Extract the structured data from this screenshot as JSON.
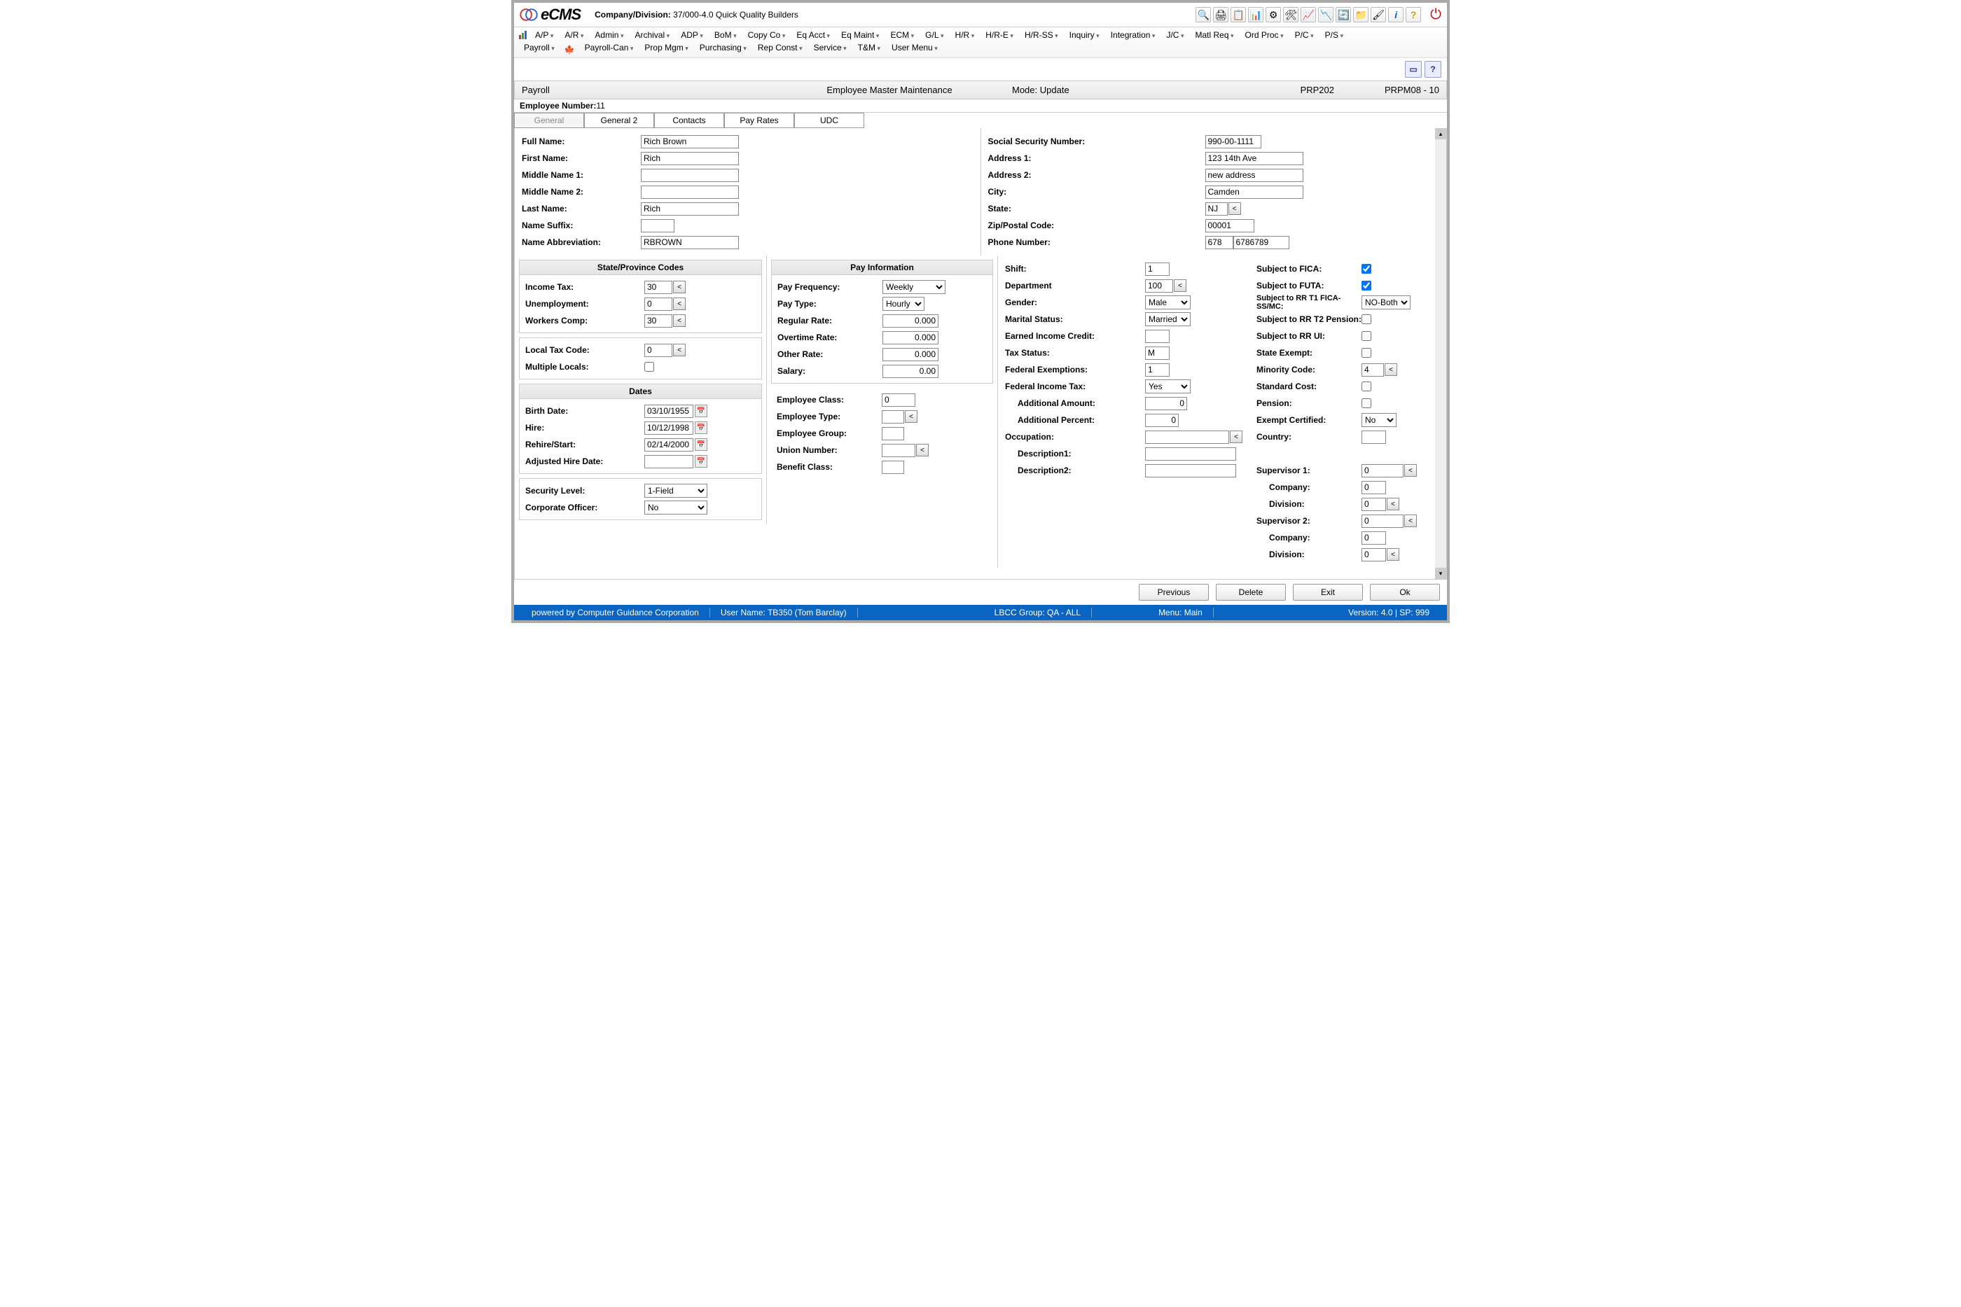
{
  "header": {
    "app_name": "eCMS",
    "company_division_label": "Company/Division:",
    "company_division_value": "37/000-4.0 Quick Quality Builders"
  },
  "toolbar_icons": [
    "🔍",
    "🖨",
    "📋",
    "📊",
    "⚙",
    "🛠",
    "📈",
    "📉",
    "🔄",
    "📁",
    "🖌",
    "ℹ",
    "?"
  ],
  "menu_row1": [
    "A/P",
    "A/R",
    "Admin",
    "Archival",
    "ADP",
    "BoM",
    "Copy Co",
    "Eq Acct",
    "Eq Maint",
    "ECM",
    "G/L",
    "H/R",
    "H/R-E",
    "H/R-SS",
    "Inquiry",
    "Integration",
    "J/C",
    "Matl Req",
    "Ord Proc",
    "P/C",
    "P/S"
  ],
  "menu_row2": [
    "Payroll",
    "Payroll-Can",
    "Prop Mgm",
    "Purchasing",
    "Rep Const",
    "Service",
    "T&M",
    "User Menu"
  ],
  "title": {
    "module": "Payroll",
    "screen": "Employee Master Maintenance",
    "mode_label": "Mode:",
    "mode_value": "Update",
    "code1": "PRP202",
    "code2": "PRPM08 - 10"
  },
  "emp": {
    "label": "Employee Number:",
    "value": "11"
  },
  "tabs": [
    "General",
    "General 2",
    "Contacts",
    "Pay Rates",
    "UDC"
  ],
  "personal": {
    "full_name_l": "Full Name:",
    "full_name": "Rich Brown",
    "first_name_l": "First Name:",
    "first_name": "Rich",
    "mid1_l": "Middle Name 1:",
    "mid1": "",
    "mid2_l": "Middle Name 2:",
    "mid2": "",
    "last_l": "Last Name:",
    "last": "Rich",
    "suffix_l": "Name Suffix:",
    "suffix": "",
    "abbr_l": "Name Abbreviation:",
    "abbr": "RBROWN",
    "ssn_l": "Social Security Number:",
    "ssn": "990-00-1111",
    "addr1_l": "Address 1:",
    "addr1": "123 14th Ave",
    "addr2_l": "Address 2:",
    "addr2": "new address",
    "city_l": "City:",
    "city": "Camden",
    "state_l": "State:",
    "state": "NJ",
    "zip_l": "Zip/Postal Code:",
    "zip": "00001",
    "phone_l": "Phone Number:",
    "phone_area": "678",
    "phone_num": "6786789"
  },
  "state_codes": {
    "head": "State/Province Codes",
    "income_l": "Income Tax:",
    "income": "30",
    "unemp_l": "Unemployment:",
    "unemp": "0",
    "wc_l": "Workers Comp:",
    "wc": "30",
    "local_l": "Local Tax Code:",
    "local": "0",
    "multi_l": "Multiple Locals:"
  },
  "dates": {
    "head": "Dates",
    "birth_l": "Birth Date:",
    "birth": "03/10/1955",
    "hire_l": "Hire:",
    "hire": "10/12/1998",
    "rehire_l": "Rehire/Start:",
    "rehire": "02/14/2000",
    "adj_l": "Adjusted Hire Date:",
    "adj": ""
  },
  "sec": {
    "level_l": "Security Level:",
    "level": "1-Field",
    "corp_l": "Corporate Officer:",
    "corp": "No"
  },
  "payinfo": {
    "head": "Pay Information",
    "freq_l": "Pay Frequency:",
    "freq": "Weekly",
    "type_l": "Pay Type:",
    "type": "Hourly",
    "reg_l": "Regular Rate:",
    "reg": "0.000",
    "ot_l": "Overtime Rate:",
    "ot": "0.000",
    "other_l": "Other Rate:",
    "other": "0.000",
    "sal_l": "Salary:",
    "sal": "0.00",
    "class_l": "Employee Class:",
    "class": "0",
    "etype_l": "Employee Type:",
    "etype": "",
    "group_l": "Employee Group:",
    "group": "",
    "union_l": "Union Number:",
    "union": "",
    "benefit_l": "Benefit Class:",
    "benefit": ""
  },
  "mid": {
    "shift_l": "Shift:",
    "shift": "1",
    "dept_l": "Department",
    "dept": "100",
    "gender_l": "Gender:",
    "gender": "Male",
    "marital_l": "Marital Status:",
    "marital": "Married",
    "eic_l": "Earned Income Credit:",
    "eic": "",
    "taxstat_l": "Tax Status:",
    "taxstat": "M",
    "fedex_l": "Federal Exemptions:",
    "fedex": "1",
    "fit_l": "Federal Income Tax:",
    "fit": "Yes",
    "addamt_l": "Additional Amount:",
    "addamt": "0",
    "addpct_l": "Additional Percent:",
    "addpct": "0",
    "occ_l": "Occupation:",
    "occ": "",
    "desc1_l": "Description1:",
    "desc1": "",
    "desc2_l": "Description2:",
    "desc2": ""
  },
  "right": {
    "fica_l": "Subject to FICA:",
    "futa_l": "Subject to FUTA:",
    "rrt1_l": "Subject to RR T1 FICA-SS/MC:",
    "rrt1": "NO-Both",
    "rrt2_l": "Subject to RR T2 Pension:",
    "rrui_l": "Subject to RR UI:",
    "stex_l": "State Exempt:",
    "min_l": "Minority Code:",
    "min": "4",
    "std_l": "Standard Cost:",
    "pension_l": "Pension:",
    "excert_l": "Exempt Certified:",
    "excert": "No",
    "country_l": "Country:",
    "country": "",
    "sup1_l": "Supervisor 1:",
    "sup1": "0",
    "comp1_l": "Company:",
    "comp1": "0",
    "div1_l": "Division:",
    "div1": "0",
    "sup2_l": "Supervisor 2:",
    "sup2": "0",
    "comp2_l": "Company:",
    "comp2": "0",
    "div2_l": "Division:",
    "div2": "0"
  },
  "actions": {
    "prev": "Previous",
    "del": "Delete",
    "exit": "Exit",
    "ok": "Ok"
  },
  "footer": {
    "powered": "powered by Computer Guidance Corporation",
    "user": "User Name:  TB350 (Tom Barclay)",
    "lbcc": "LBCC Group:  QA - ALL",
    "menu": "Menu:  Main",
    "ver": "Version: 4.0  |  SP: 999"
  }
}
